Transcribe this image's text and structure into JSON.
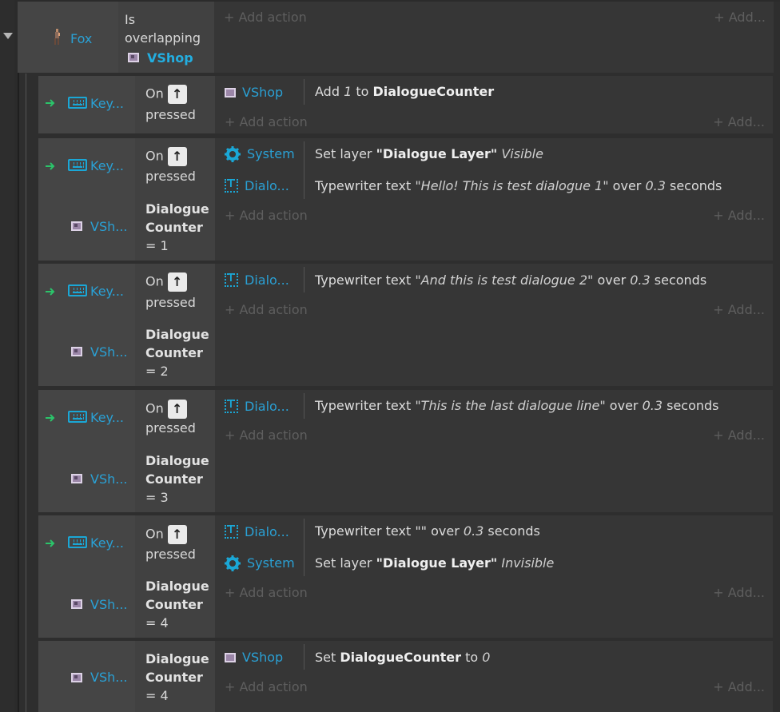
{
  "parent_event": {
    "object": "Fox",
    "condition_lines": [
      "Is",
      "overlapping"
    ],
    "condition_target": "VShop",
    "add_action": "+ Add action",
    "add_right": "+ Add..."
  },
  "common": {
    "key_object": "Key...",
    "vshop_short": "VSh...",
    "on": "On",
    "pressed": "pressed",
    "up_arrow": "↑",
    "dialogue": "Dialogue",
    "counter": "Counter",
    "add_action": "+ Add action",
    "add_right": "+ Add..."
  },
  "events": [
    {
      "compare": "",
      "actions": [
        {
          "icon": "sprite-icon",
          "object": "VShop",
          "pre": "Add ",
          "i1": "1",
          "mid": " to ",
          "b1": "DialogueCounter",
          "post": ""
        }
      ]
    },
    {
      "compare": "= 1",
      "actions": [
        {
          "icon": "gear-icon",
          "object": "System",
          "pre": "Set layer ",
          "b1": "\"Dialogue Layer\"",
          "mid": " ",
          "i1": "Visible",
          "post": ""
        },
        {
          "icon": "text-icon",
          "object": "Dialo...",
          "pre": "Typewriter text ",
          "i1": "\"Hello! This is test dialogue 1\"",
          "mid": " over ",
          "i2": "0.3",
          "post": " seconds"
        }
      ]
    },
    {
      "compare": "= 2",
      "actions": [
        {
          "icon": "text-icon",
          "object": "Dialo...",
          "pre": "Typewriter text ",
          "i1": "\"And this is test dialogue 2\"",
          "mid": " over ",
          "i2": "0.3",
          "post": " seconds"
        }
      ]
    },
    {
      "compare": "= 3",
      "actions": [
        {
          "icon": "text-icon",
          "object": "Dialo...",
          "pre": "Typewriter text ",
          "i1": "\"This is the last dialogue line\"",
          "mid": " over ",
          "i2": "0.3",
          "post": " seconds"
        }
      ]
    },
    {
      "compare": "= 4",
      "actions": [
        {
          "icon": "text-icon",
          "object": "Dialo...",
          "pre": "Typewriter text ",
          "i1": "\"\"",
          "mid": " over ",
          "i2": "0.3",
          "post": " seconds"
        },
        {
          "icon": "gear-icon",
          "object": "System",
          "pre": "Set layer ",
          "b1": "\"Dialogue Layer\"",
          "mid": " ",
          "i1": "Invisible",
          "post": ""
        }
      ]
    },
    {
      "compare": "= 4",
      "actions": [
        {
          "icon": "sprite-icon",
          "object": "VShop",
          "pre": "Set ",
          "b1": "DialogueCounter",
          "mid": " to ",
          "i1": "0",
          "post": ""
        }
      ]
    }
  ]
}
